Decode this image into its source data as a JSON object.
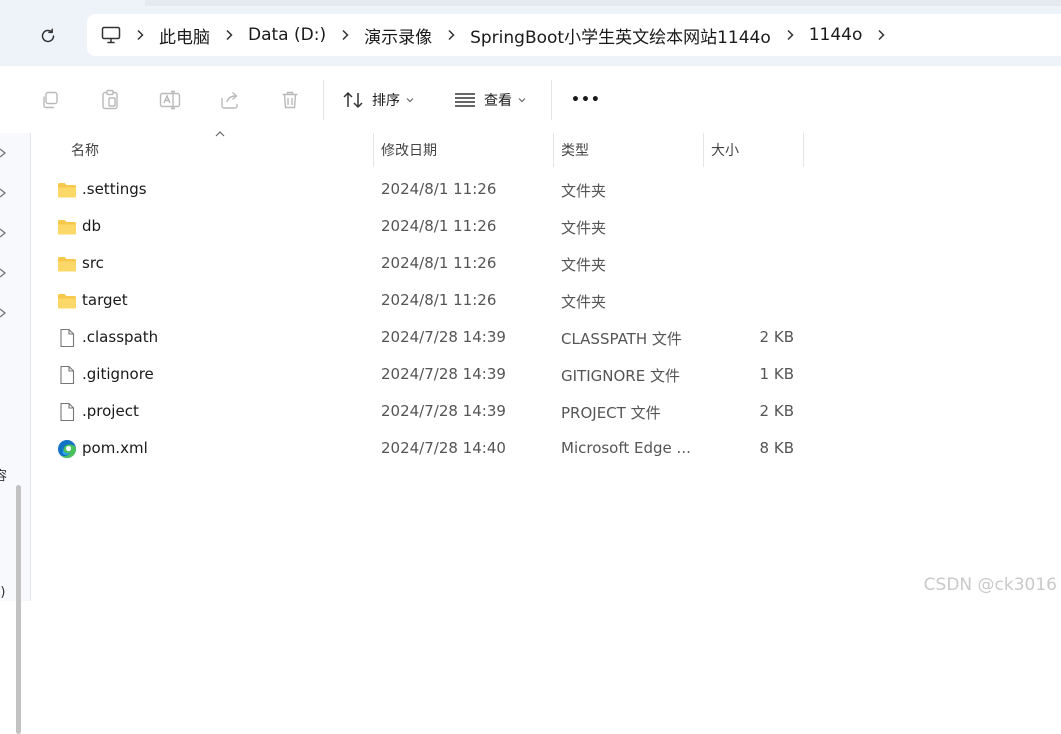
{
  "address": {
    "crumbs": [
      "此电脑",
      "Data (D:)",
      "演示录像",
      "SpringBoot小学生英文绘本网站1144o",
      "1144o"
    ]
  },
  "toolbar": {
    "sort_label": "排序",
    "view_label": "查看",
    "more_label": "•••"
  },
  "columns": {
    "name": "名称",
    "modified": "修改日期",
    "type": "类型",
    "size": "大小"
  },
  "files": [
    {
      "name": ".settings",
      "modified": "2024/8/1 11:26",
      "type": "文件夹",
      "size": "",
      "icon": "folder-icon"
    },
    {
      "name": "db",
      "modified": "2024/8/1 11:26",
      "type": "文件夹",
      "size": "",
      "icon": "folder-icon"
    },
    {
      "name": "src",
      "modified": "2024/8/1 11:26",
      "type": "文件夹",
      "size": "",
      "icon": "folder-icon"
    },
    {
      "name": "target",
      "modified": "2024/8/1 11:26",
      "type": "文件夹",
      "size": "",
      "icon": "folder-icon"
    },
    {
      "name": ".classpath",
      "modified": "2024/7/28 14:39",
      "type": "CLASSPATH 文件",
      "size": "2 KB",
      "icon": "file-icon"
    },
    {
      "name": ".gitignore",
      "modified": "2024/7/28 14:39",
      "type": "GITIGNORE 文件",
      "size": "1 KB",
      "icon": "file-icon"
    },
    {
      "name": ".project",
      "modified": "2024/7/28 14:39",
      "type": "PROJECT 文件",
      "size": "2 KB",
      "icon": "file-icon"
    },
    {
      "name": "pom.xml",
      "modified": "2024/7/28 14:40",
      "type": "Microsoft Edge ...",
      "size": "8 KB",
      "icon": "edge-icon"
    }
  ],
  "nav_fragments": [
    "容",
    ":)"
  ],
  "watermark": "CSDN @ck3016",
  "colors": {
    "folder": "#f8c84b",
    "addr_bg": "#eef2f9",
    "edge_blue": "#1273c4",
    "edge_green": "#49c35a"
  }
}
